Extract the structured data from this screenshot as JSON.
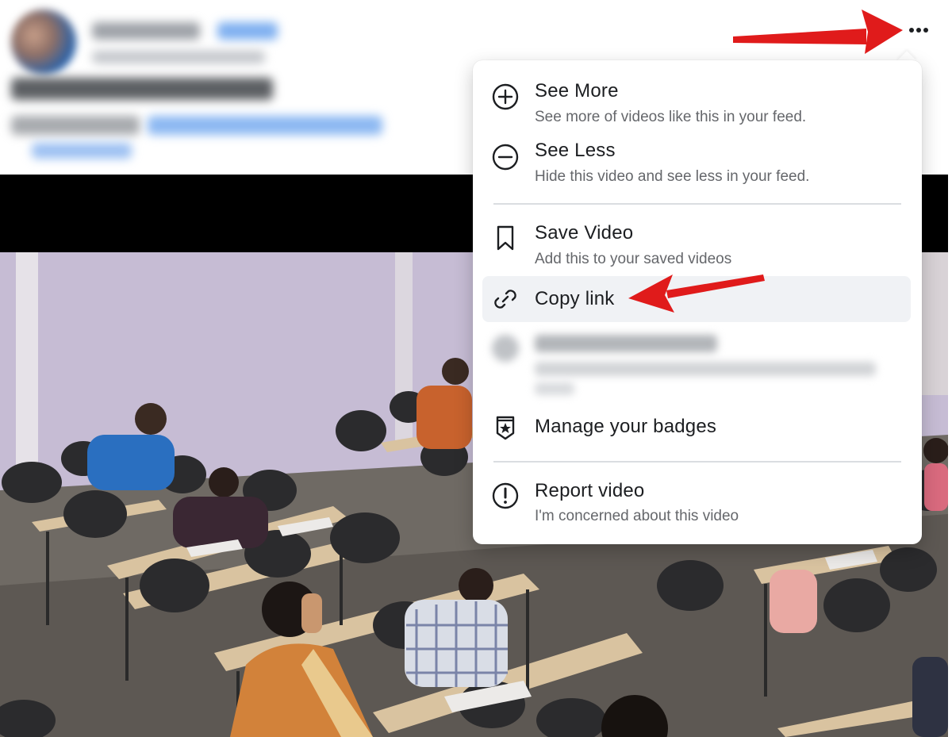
{
  "post": {
    "more_options_label": "More options"
  },
  "menu": {
    "items": [
      {
        "label": "See More",
        "description": "See more of videos like this in your feed."
      },
      {
        "label": "See Less",
        "description": "Hide this video and see less in your feed."
      },
      {
        "label": "Save Video",
        "description": "Add this to your saved videos"
      },
      {
        "label": "Copy link"
      },
      {
        "label": "Manage your badges"
      },
      {
        "label": "Report video",
        "description": "I'm concerned about this video"
      }
    ]
  },
  "annotations": {
    "arrow_color": "#e01b1b"
  },
  "colors": {
    "menu_text": "#1c1e21",
    "menu_subtext": "#65676b",
    "highlight_bg": "#f0f2f5",
    "link_blue": "#1877f2"
  }
}
